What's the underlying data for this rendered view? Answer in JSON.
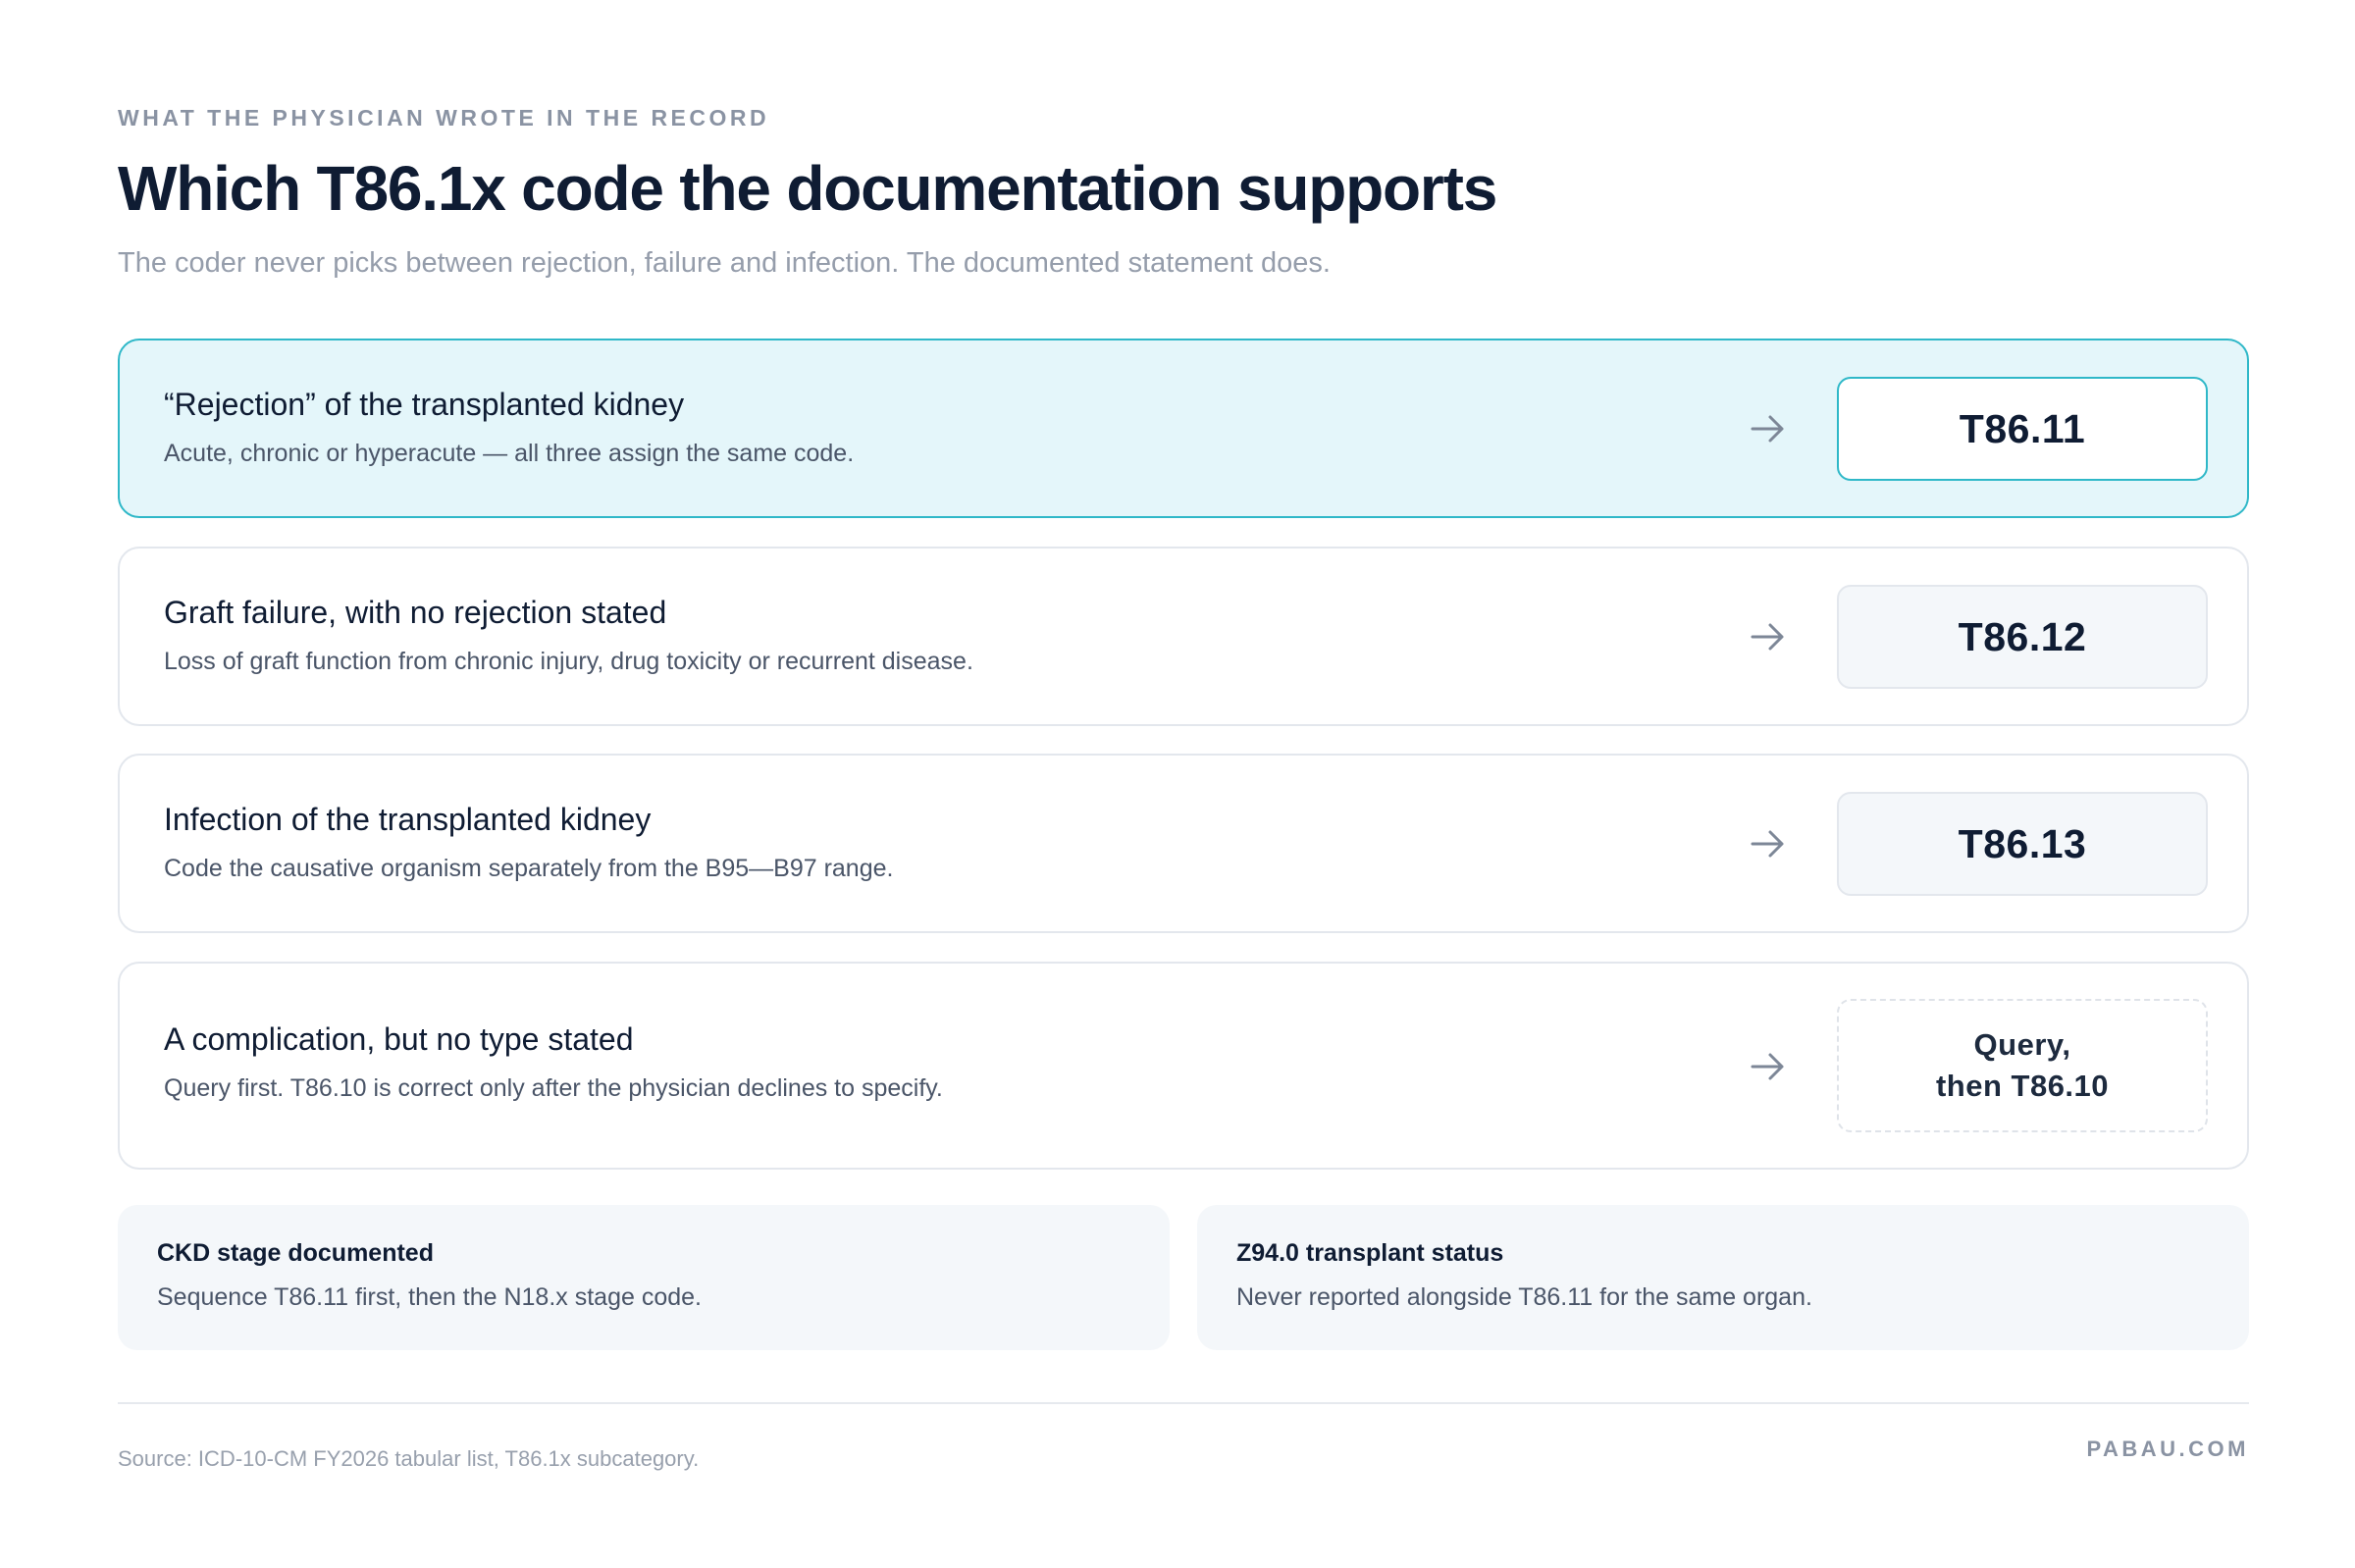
{
  "header": {
    "eyebrow": "WHAT THE PHYSICIAN WROTE IN THE RECORD",
    "title": "Which T86.1x code the documentation supports",
    "subtitle": "The coder never picks between rejection, failure and infection. The documented statement does."
  },
  "rules": [
    {
      "label": "“Rejection” of the transplanted kidney",
      "description": "Acute, chronic or hyperacute — all three assign the same code.",
      "code": "T86.11",
      "highlighted": true
    },
    {
      "label": "Graft failure, with no rejection stated",
      "description": "Loss of graft function from chronic injury, drug toxicity or recurrent disease.",
      "code": "T86.12",
      "highlighted": false
    },
    {
      "label": "Infection of the transplanted kidney",
      "description": "Code the causative organism separately from the B95—B97 range.",
      "code": "T86.13",
      "highlighted": false
    },
    {
      "label": "A complication, but no type stated",
      "description": "Query first. T86.10 is correct only after the physician declines to specify.",
      "code_line1": "Query,",
      "code_line2": "then T86.10",
      "highlighted": false
    }
  ],
  "notes": [
    {
      "title": "CKD stage documented",
      "text": "Sequence T86.11 first, then the N18.x stage code."
    },
    {
      "title": "Z94.0 transplant status",
      "text": "Never reported alongside T86.11 for the same organ."
    }
  ],
  "footer": {
    "source": "Source: ICD-10-CM FY2026 tabular list, T86.1x subcategory.",
    "brand": "PABAU.COM"
  },
  "colors": {
    "accent": "#2fb8c8",
    "highlight_bg": "#e4f6fa",
    "text_dark": "#0f1c33",
    "text_muted": "#959dab"
  },
  "icons": {
    "arrow": "arrow-right-icon"
  }
}
